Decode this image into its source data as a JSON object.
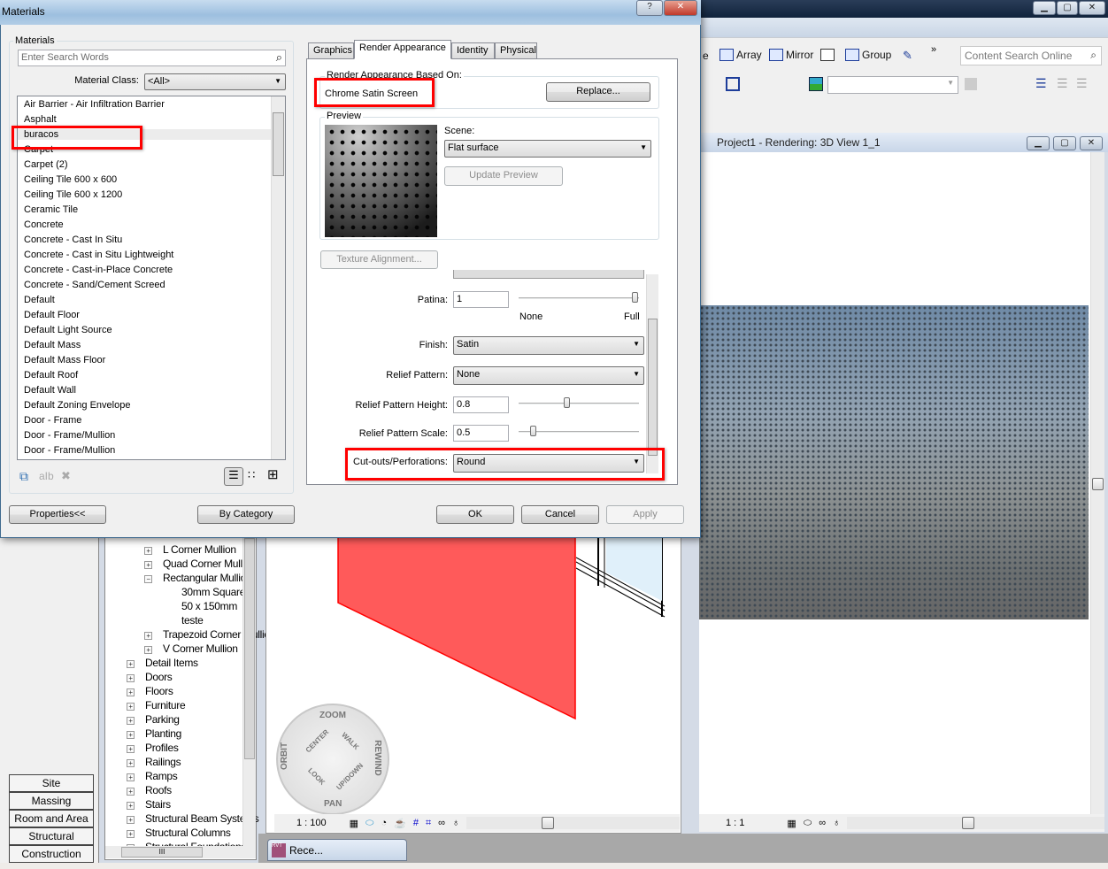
{
  "app": {
    "toolbar": {
      "array": "Array",
      "mirror": "Mirror",
      "group": "Group",
      "more": "»",
      "search_placeholder": "Content Search Online",
      "cut_label": "e"
    },
    "render_view": {
      "title": "Project1 - Rendering: 3D View 1_1",
      "scale": "1 : 1"
    },
    "model_view": {
      "scale": "1 : 100",
      "wheel": {
        "zoom": "ZOOM",
        "orbit": "ORBIT",
        "rewind": "REWIND",
        "pan": "PAN",
        "center": "CENTER",
        "walk": "WALK",
        "look": "LOOK",
        "updown": "UP/DOWN"
      }
    },
    "disciplines": [
      "Site",
      "Massing",
      "Room and Area",
      "Structural",
      "Construction"
    ],
    "tree": [
      {
        "label": "L Corner Mullion",
        "level": 2,
        "sign": "+"
      },
      {
        "label": "Quad Corner Mullion",
        "level": 2,
        "sign": "+"
      },
      {
        "label": "Rectangular Mullion",
        "level": 2,
        "sign": "−"
      },
      {
        "label": "30mm Square",
        "level": 3,
        "sign": ""
      },
      {
        "label": "50 x 150mm",
        "level": 3,
        "sign": ""
      },
      {
        "label": "teste",
        "level": 3,
        "sign": ""
      },
      {
        "label": "Trapezoid Corner Mullion",
        "level": 2,
        "sign": "+"
      },
      {
        "label": "V Corner Mullion",
        "level": 2,
        "sign": "+"
      },
      {
        "label": "Detail Items",
        "level": 1,
        "sign": "+"
      },
      {
        "label": "Doors",
        "level": 1,
        "sign": "+"
      },
      {
        "label": "Floors",
        "level": 1,
        "sign": "+"
      },
      {
        "label": "Furniture",
        "level": 1,
        "sign": "+"
      },
      {
        "label": "Parking",
        "level": 1,
        "sign": "+"
      },
      {
        "label": "Planting",
        "level": 1,
        "sign": "+"
      },
      {
        "label": "Profiles",
        "level": 1,
        "sign": "+"
      },
      {
        "label": "Railings",
        "level": 1,
        "sign": "+"
      },
      {
        "label": "Ramps",
        "level": 1,
        "sign": "+"
      },
      {
        "label": "Roofs",
        "level": 1,
        "sign": "+"
      },
      {
        "label": "Stairs",
        "level": 1,
        "sign": "+"
      },
      {
        "label": "Structural Beam Systems",
        "level": 1,
        "sign": "+"
      },
      {
        "label": "Structural Columns",
        "level": 1,
        "sign": "+"
      },
      {
        "label": "Structural Foundations",
        "level": 1,
        "sign": "+"
      }
    ],
    "tree_hscroll": "III",
    "minimized_window": "Rece..."
  },
  "dialog": {
    "title": "Materials",
    "help": "?",
    "close": "✕",
    "materials_group": "Materials",
    "search_placeholder": "Enter Search Words",
    "material_class_label": "Material Class:",
    "material_class_value": "<All>",
    "materials": [
      "Air Barrier - Air Infiltration Barrier",
      "Asphalt",
      "buracos",
      "Carpet",
      "Carpet (2)",
      "Ceiling Tile 600 x 600",
      "Ceiling Tile 600 x 1200",
      "Ceramic Tile",
      "Concrete",
      "Concrete - Cast In Situ",
      "Concrete - Cast in Situ Lightweight",
      "Concrete - Cast-in-Place Concrete",
      "Concrete - Sand/Cement Screed",
      "Default",
      "Default Floor",
      "Default Light Source",
      "Default Mass",
      "Default Mass Floor",
      "Default Roof",
      "Default Wall",
      "Default Zoning Envelope",
      "Door - Frame",
      "Door - Frame/Mullion",
      "Door - Frame/Mullion"
    ],
    "selected_material": "buracos",
    "properties_button": "Properties<<",
    "by_category_button": "By Category",
    "tabs": [
      "Graphics",
      "Render Appearance",
      "Identity",
      "Physical"
    ],
    "active_tab": "Render Appearance",
    "based_on_label": "Render Appearance Based On:",
    "based_on_value": "Chrome Satin Screen",
    "replace_button": "Replace...",
    "preview_label": "Preview",
    "scene_label": "Scene:",
    "scene_value": "Flat surface",
    "update_preview": "Update Preview",
    "texture_alignment": "Texture Alignment...",
    "patina": {
      "label": "Patina:",
      "value": "1",
      "min": "None",
      "max": "Full",
      "slider": 1.0
    },
    "finish": {
      "label": "Finish:",
      "value": "Satin"
    },
    "relief_pattern": {
      "label": "Relief Pattern:",
      "value": "None"
    },
    "relief_height": {
      "label": "Relief Pattern Height:",
      "value": "0.8",
      "slider": 0.4
    },
    "relief_scale": {
      "label": "Relief Pattern Scale:",
      "value": "0.5",
      "slider": 0.1
    },
    "cutouts": {
      "label": "Cut-outs/Perforations:",
      "value": "Round"
    },
    "ok": "OK",
    "cancel": "Cancel",
    "apply": "Apply",
    "highlight_color": "#ff0000"
  }
}
